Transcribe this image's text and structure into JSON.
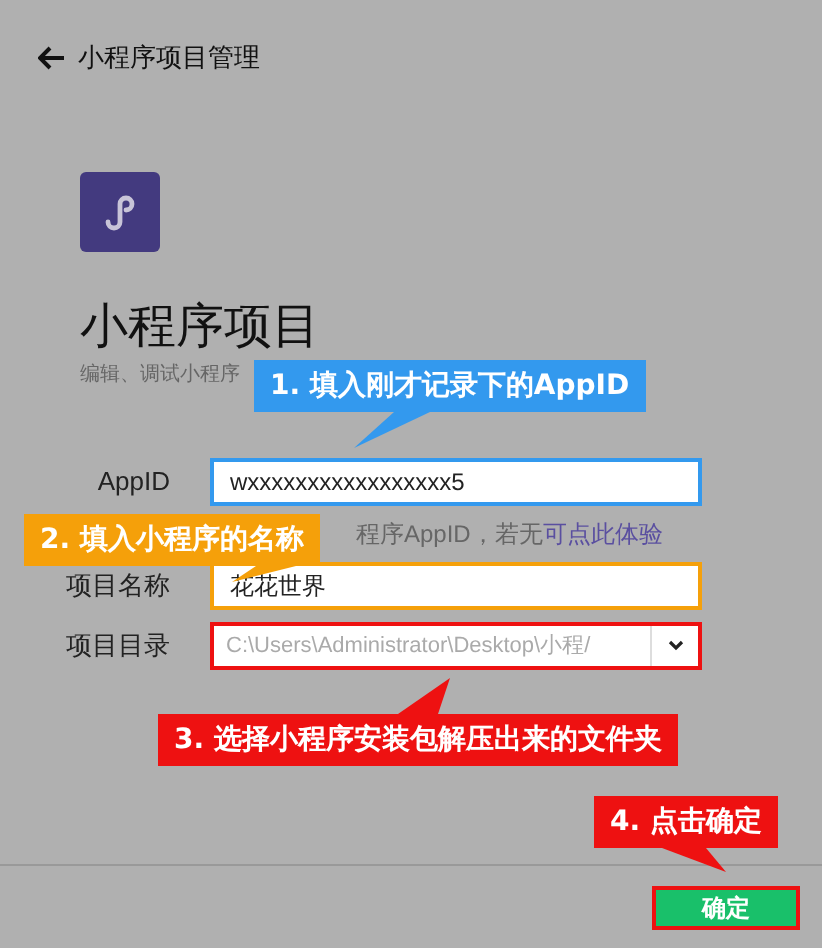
{
  "header": {
    "title": "小程序项目管理"
  },
  "project": {
    "title": "小程序项目",
    "subtitle": "编辑、调试小程序"
  },
  "form": [
    {
      "kind": "text",
      "label": "AppID",
      "value": "wxxxxxxxxxxxxxxxxx5",
      "color": "#3399ee"
    },
    {
      "kind": "hint",
      "text": "程序AppID，若无",
      "link": "可点此体验"
    },
    {
      "kind": "text",
      "label": "项目名称",
      "value": "花花世界",
      "color": "#f5a00a"
    },
    {
      "kind": "select",
      "label": "项目目录",
      "value": "C:\\Users\\Administrator\\Desktop\\小程/",
      "color": "#ee1111"
    }
  ],
  "callouts": [
    {
      "text": "1. 填入刚才记录下的AppID",
      "color": "#3399ee"
    },
    {
      "text": "2. 填入小程序的名称",
      "color": "#f5a00a"
    },
    {
      "text": "3. 选择小程序安装包解压出来的文件夹",
      "color": "#ee1111"
    },
    {
      "text": "4. 点击确定",
      "color": "#ee1111"
    }
  ],
  "footer": {
    "confirm": "确定"
  }
}
